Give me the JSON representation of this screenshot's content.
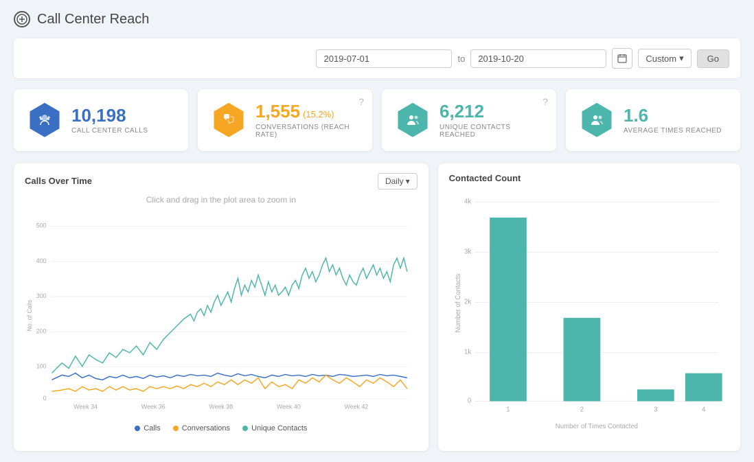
{
  "page": {
    "title": "Call Center Reach",
    "icon": "●"
  },
  "filter": {
    "date_from": "2019-07-01",
    "date_to": "2019-10-20",
    "preset": "Custom",
    "go_label": "Go",
    "to_label": "to"
  },
  "stats": [
    {
      "id": "calls",
      "value": "10,198",
      "label": "CALL CENTER CALLS",
      "icon_type": "blue",
      "icon_symbol": "🎧",
      "badge": null,
      "has_help": false
    },
    {
      "id": "conversations",
      "value": "1,555",
      "label": "CONVERSATIONS (REACH RATE)",
      "icon_type": "orange",
      "icon_symbol": "📞",
      "badge": "(15.2%)",
      "has_help": true
    },
    {
      "id": "unique_contacts",
      "value": "6,212",
      "label": "UNIQUE CONTACTS REACHED",
      "icon_type": "teal",
      "icon_symbol": "👥",
      "badge": null,
      "has_help": true
    },
    {
      "id": "average",
      "value": "1.6",
      "label": "AVERAGE TIMES REACHED",
      "icon_type": "teal2",
      "icon_symbol": "👥",
      "badge": null,
      "has_help": false
    }
  ],
  "calls_chart": {
    "title": "Calls Over Time",
    "hint": "Click and drag in the plot area to zoom in",
    "daily_label": "Daily",
    "y_label": "No. of Calls",
    "x_labels": [
      "Week 34",
      "Week 36",
      "Week 38",
      "Week 40",
      "Week 42"
    ],
    "y_labels": [
      "500",
      "400",
      "300",
      "200",
      "100",
      "0"
    ],
    "legend": [
      {
        "label": "Calls",
        "color": "#3a6fc4"
      },
      {
        "label": "Conversations",
        "color": "#f5a623"
      },
      {
        "label": "Unique Contacts",
        "color": "#4db6ac"
      }
    ]
  },
  "contacted_chart": {
    "title": "Contacted Count",
    "y_label": "Number of Contacts",
    "x_label": "Number of Times Contacted",
    "x_labels": [
      "1",
      "2",
      "3",
      "4"
    ],
    "y_labels": [
      "4k",
      "3k",
      "2k",
      "1k",
      "0"
    ],
    "bars": [
      {
        "x": "1",
        "height_pct": 92,
        "value": "~3700"
      },
      {
        "x": "2",
        "height_pct": 42,
        "value": "~1680"
      },
      {
        "x": "3",
        "height_pct": 6,
        "value": "~240"
      },
      {
        "x": "4",
        "height_pct": 14,
        "value": "~560"
      }
    ]
  }
}
